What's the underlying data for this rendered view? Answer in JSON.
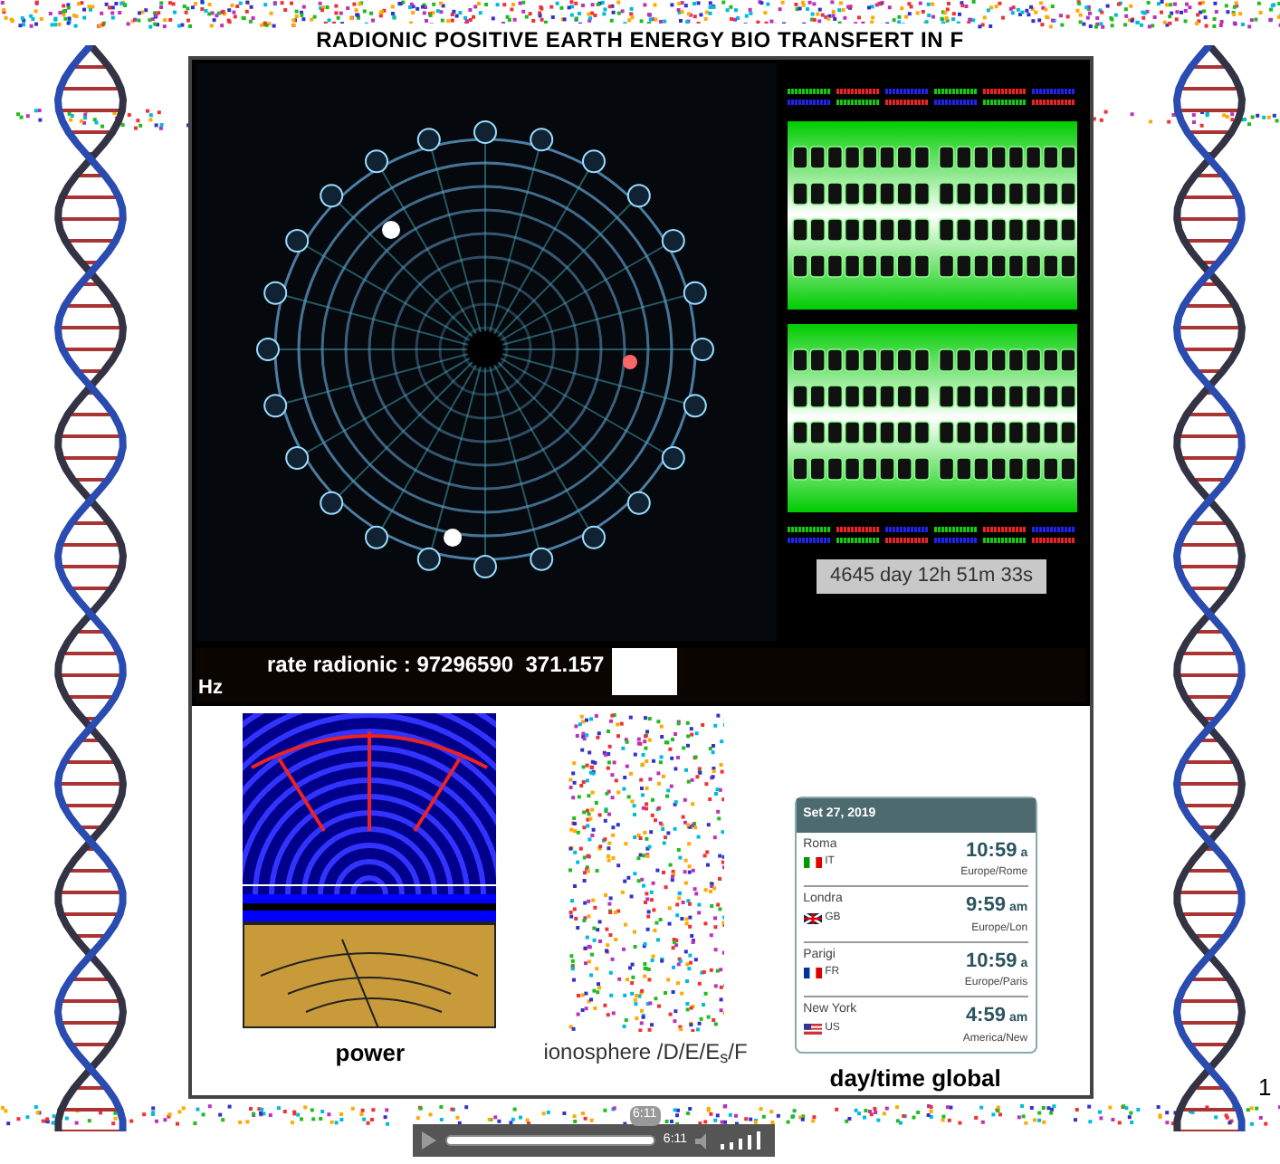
{
  "page_title": "RADIONIC POSITIVE EARTH ENERGY BIO TRANSFERT IN F",
  "counter": "4645 day 12h 51m 33s",
  "rate": {
    "label": "rate radionic : 97296590  371.157",
    "unit": "Hz"
  },
  "panels": [
    {
      "kind": "power",
      "caption": "power"
    },
    {
      "kind": "ionosphere",
      "caption": "ionosphere /D/E/E$_{s}$/F"
    },
    {
      "kind": "clock",
      "caption": "day/time global"
    }
  ],
  "clock": {
    "date": "Set 27, 2019",
    "cities": [
      {
        "city": "Roma",
        "country": "IT",
        "time": "10:59",
        "ampm": "a",
        "zone": "Europe/Rome",
        "kind": "it"
      },
      {
        "city": "Londra",
        "country": "GB",
        "time": "9:59",
        "ampm": "am",
        "zone": "Europe/Lon",
        "kind": "gb"
      },
      {
        "city": "Parigi",
        "country": "FR",
        "time": "10:59",
        "ampm": "a",
        "zone": "Europe/Paris",
        "kind": "fr"
      },
      {
        "city": "New York",
        "country": "US",
        "time": "4:59",
        "ampm": "am",
        "zone": "America/New",
        "kind": "us"
      }
    ]
  },
  "audio": {
    "tooltip": "6:11",
    "time": "6:11",
    "level": 1
  },
  "page_number": "1"
}
